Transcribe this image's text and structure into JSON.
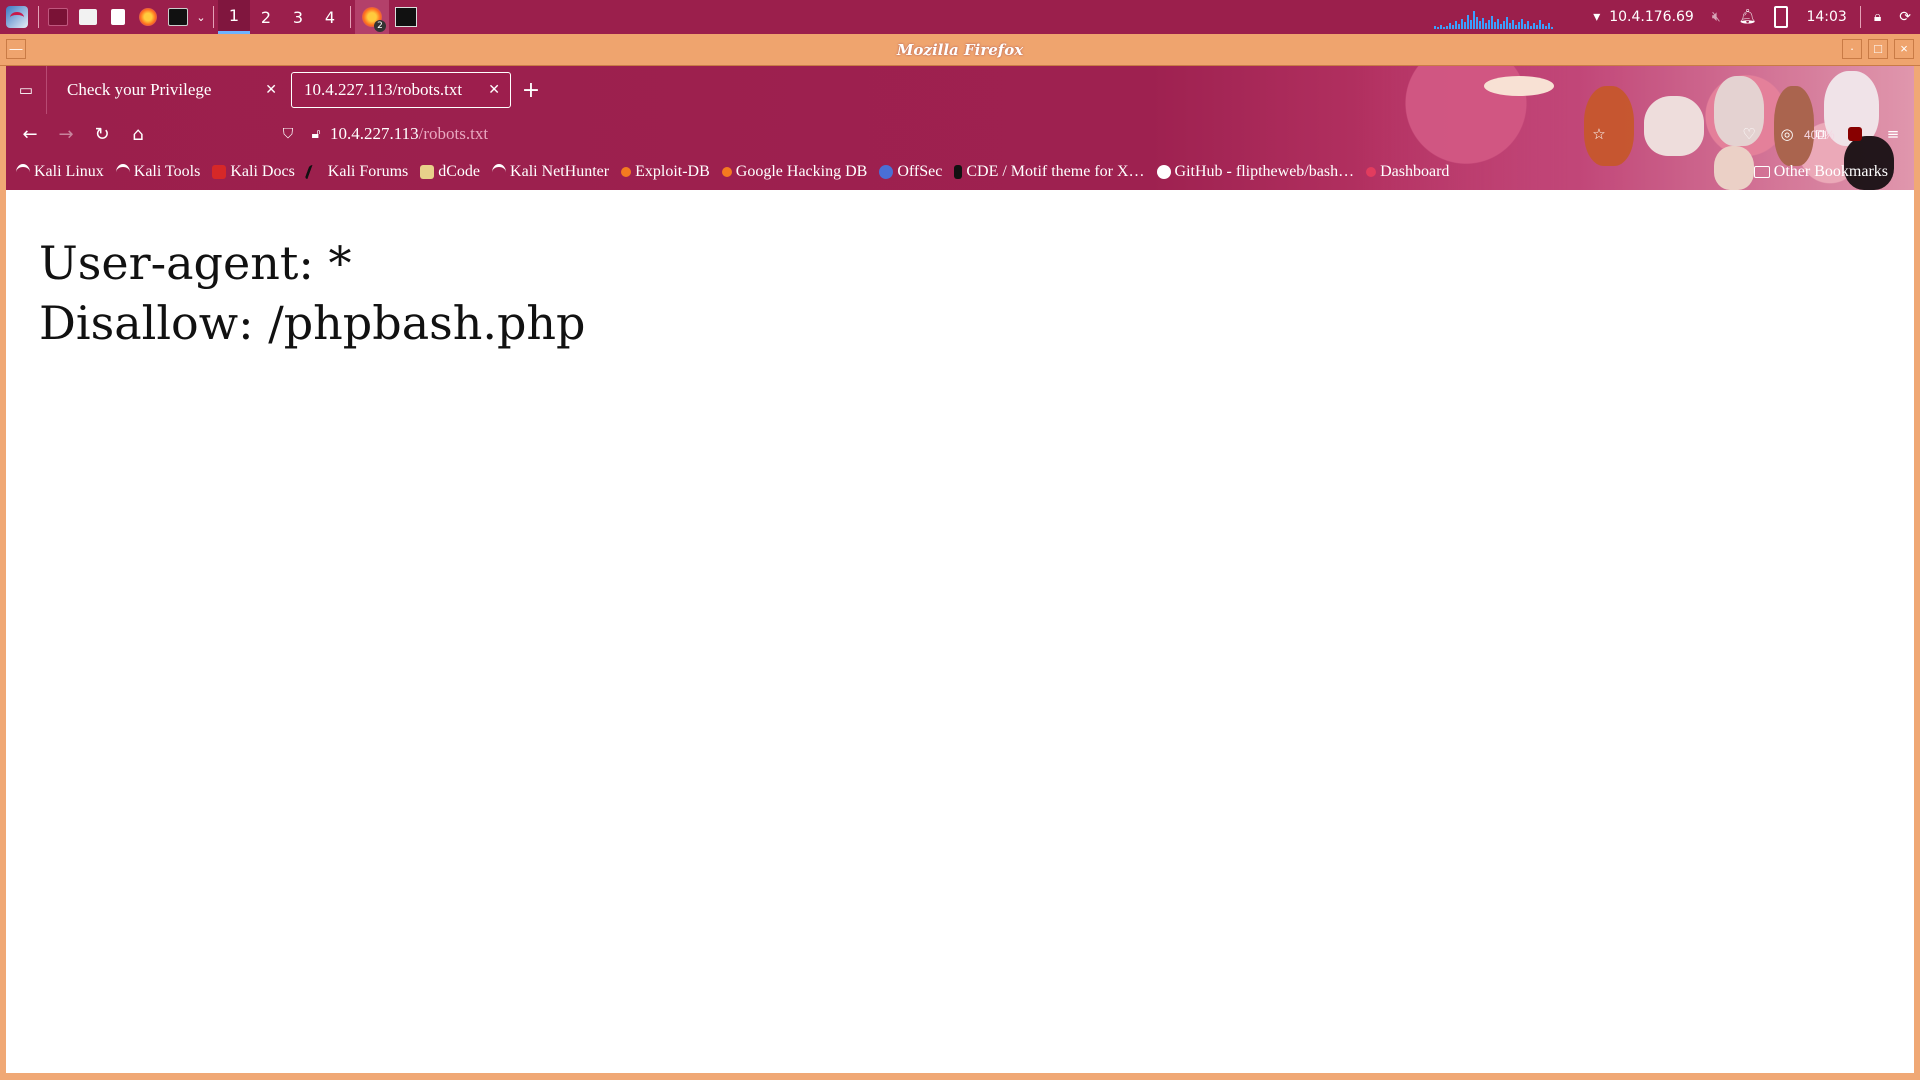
{
  "panel": {
    "workspaces": [
      "1",
      "2",
      "3",
      "4"
    ],
    "active_workspace": "1",
    "ip_address": "10.4.176.69",
    "clock": "14:03",
    "firefox_badge": "2",
    "accent_color": "#9b1f4c"
  },
  "window": {
    "title": "Mozilla Firefox"
  },
  "tabs": [
    {
      "label": "Check your Privilege"
    },
    {
      "label": "10.4.227.113/robots.txt"
    }
  ],
  "nav": {
    "url_host": "10.4.227.113",
    "url_path": "/robots.txt",
    "zoom": "400%"
  },
  "bookmarks": [
    {
      "label": "Kali Linux",
      "icon": "kali-icon"
    },
    {
      "label": "Kali Tools",
      "icon": "kali-icon"
    },
    {
      "label": "Kali Docs",
      "icon": "kali-docs-icon"
    },
    {
      "label": "Kali Forums",
      "icon": "kali-forums-icon"
    },
    {
      "label": "dCode",
      "icon": "dcode-icon"
    },
    {
      "label": "Kali NetHunter",
      "icon": "kali-icon"
    },
    {
      "label": "Exploit-DB",
      "icon": "exploitdb-icon"
    },
    {
      "label": "Google Hacking DB",
      "icon": "exploitdb-icon"
    },
    {
      "label": "OffSec",
      "icon": "offsec-icon"
    },
    {
      "label": "CDE / Motif theme for X…",
      "icon": "cde-icon"
    },
    {
      "label": "GitHub - flipthеweb/bash…",
      "icon": "github-icon"
    },
    {
      "label": "Dashboard",
      "icon": "dashboard-icon"
    }
  ],
  "other_bookmarks": "Other Bookmarks",
  "page": {
    "line1": "User-agent: *",
    "line2": "Disallow: /phpbash.php"
  }
}
